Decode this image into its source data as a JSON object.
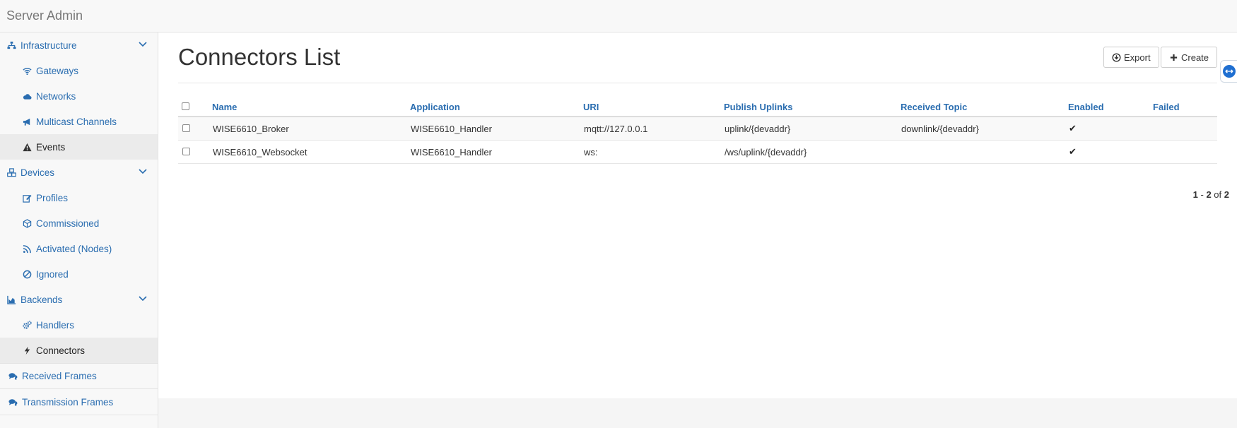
{
  "app": {
    "brand": "Server Admin"
  },
  "sidebar": {
    "infrastructure": {
      "label": "Infrastructure",
      "items": [
        "Gateways",
        "Networks",
        "Multicast Channels",
        "Events"
      ]
    },
    "devices": {
      "label": "Devices",
      "items": [
        "Profiles",
        "Commissioned",
        "Activated (Nodes)",
        "Ignored"
      ]
    },
    "backends": {
      "label": "Backends",
      "items": [
        "Handlers",
        "Connectors"
      ]
    },
    "received_frames": "Received Frames",
    "transmission_frames": "Transmission Frames",
    "active_item": "Connectors"
  },
  "main": {
    "title": "Connectors List",
    "export_label": "Export",
    "create_label": "Create"
  },
  "table": {
    "headers": [
      "Name",
      "Application",
      "URI",
      "Publish Uplinks",
      "Received Topic",
      "Enabled",
      "Failed"
    ],
    "rows": [
      {
        "name": "WISE6610_Broker",
        "application": "WISE6610_Handler",
        "uri": "mqtt://127.0.0.1",
        "publish_uplinks": "uplink/{devaddr}",
        "received_topic": "downlink/{devaddr}",
        "enabled": "✔",
        "failed": ""
      },
      {
        "name": "WISE6610_Websocket",
        "application": "WISE6610_Handler",
        "uri": "ws:",
        "publish_uplinks": "/ws/uplink/{devaddr}",
        "received_topic": "",
        "enabled": "✔",
        "failed": ""
      }
    ]
  },
  "pager": {
    "from": "1",
    "to": "2",
    "sep1": " - ",
    "of": " of ",
    "total": "2"
  },
  "colors": {
    "link": "#2a6db0",
    "remote": "#1f6fd1"
  }
}
